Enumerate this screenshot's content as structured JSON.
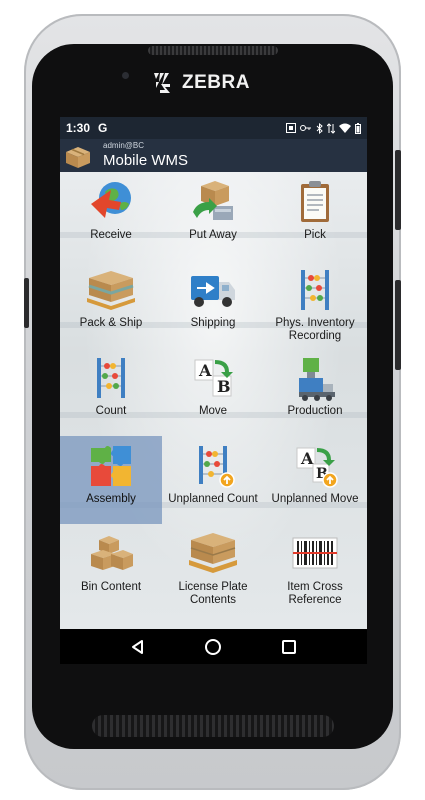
{
  "device": {
    "brand": "ZEBRA"
  },
  "status_bar": {
    "time": "1:30",
    "g_label": "G",
    "icons": [
      "nfc-icon",
      "key-icon",
      "bluetooth-icon",
      "data-icon",
      "wifi-icon",
      "battery-icon"
    ]
  },
  "app_bar": {
    "user": "admin@BC",
    "title": "Mobile WMS"
  },
  "tiles": [
    {
      "label": "Receive",
      "icon": "receive-icon"
    },
    {
      "label": "Put Away",
      "icon": "put-away-icon"
    },
    {
      "label": "Pick",
      "icon": "pick-icon"
    },
    {
      "label": "Pack & Ship",
      "icon": "pack-ship-icon"
    },
    {
      "label": "Shipping",
      "icon": "shipping-icon"
    },
    {
      "label": "Phys. Inventory Recording",
      "icon": "phys-inventory-icon"
    },
    {
      "label": "Count",
      "icon": "count-icon"
    },
    {
      "label": "Move",
      "icon": "move-icon"
    },
    {
      "label": "Production",
      "icon": "production-icon"
    },
    {
      "label": "Assembly",
      "icon": "assembly-icon",
      "selected": true
    },
    {
      "label": "Unplanned Count",
      "icon": "unplanned-count-icon"
    },
    {
      "label": "Unplanned Move",
      "icon": "unplanned-move-icon"
    },
    {
      "label": "Bin Content",
      "icon": "bin-content-icon"
    },
    {
      "label": "License Plate Contents",
      "icon": "license-plate-icon"
    },
    {
      "label": "Item Cross Reference",
      "icon": "barcode-icon"
    }
  ],
  "nav": {
    "back": "back-icon",
    "home": "home-icon",
    "recents": "recents-icon"
  },
  "colors": {
    "statusbar": "#1d2632",
    "appbar": "#263141",
    "selected": "#7896be"
  }
}
